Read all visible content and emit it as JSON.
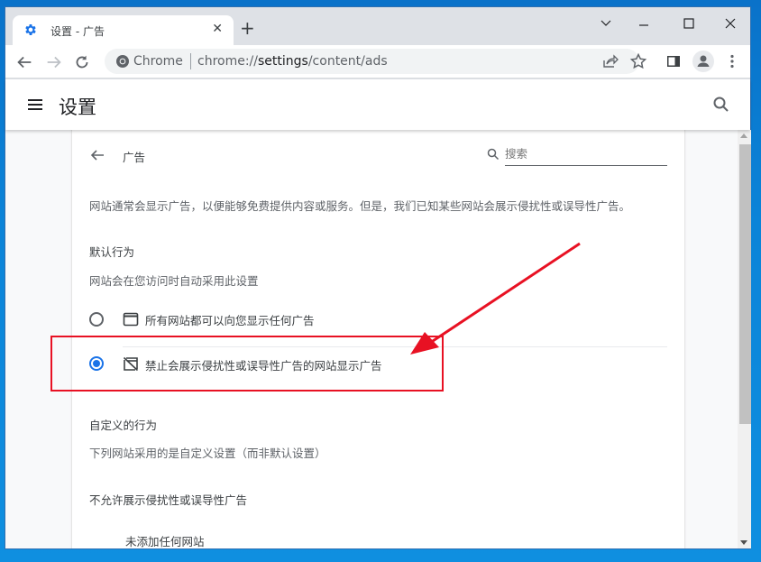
{
  "browser": {
    "tab_title": "设置 - 广告",
    "new_tab_label": "+",
    "omnibox_site": "Chrome",
    "omnibox_url_scheme": "chrome://",
    "omnibox_url_host": "settings",
    "omnibox_url_path": "/content/ads"
  },
  "header": {
    "title": "设置"
  },
  "page": {
    "title": "广告",
    "search_placeholder": "搜索",
    "description": "网站通常会显示广告，以便能够免费提供内容或服务。但是，我们已知某些网站会展示侵扰性或误导性广告。",
    "default_behavior": {
      "heading": "默认行为",
      "subtitle": "网站会在您访问时自动采用此设置",
      "options": [
        {
          "label": "所有网站都可以向您显示任何广告",
          "icon": "web-asset-icon",
          "selected": false
        },
        {
          "label": "禁止会展示侵扰性或误导性广告的网站显示广告",
          "icon": "ads-off-icon",
          "selected": true
        }
      ]
    },
    "custom_behavior": {
      "heading": "自定义的行为",
      "subtitle": "下列网站采用的是自定义设置（而非默认设置）",
      "blocked_heading": "不允许展示侵扰性或误导性广告",
      "blocked_empty": "未添加任何网站"
    }
  },
  "annotation": {
    "color": "#e81123"
  }
}
